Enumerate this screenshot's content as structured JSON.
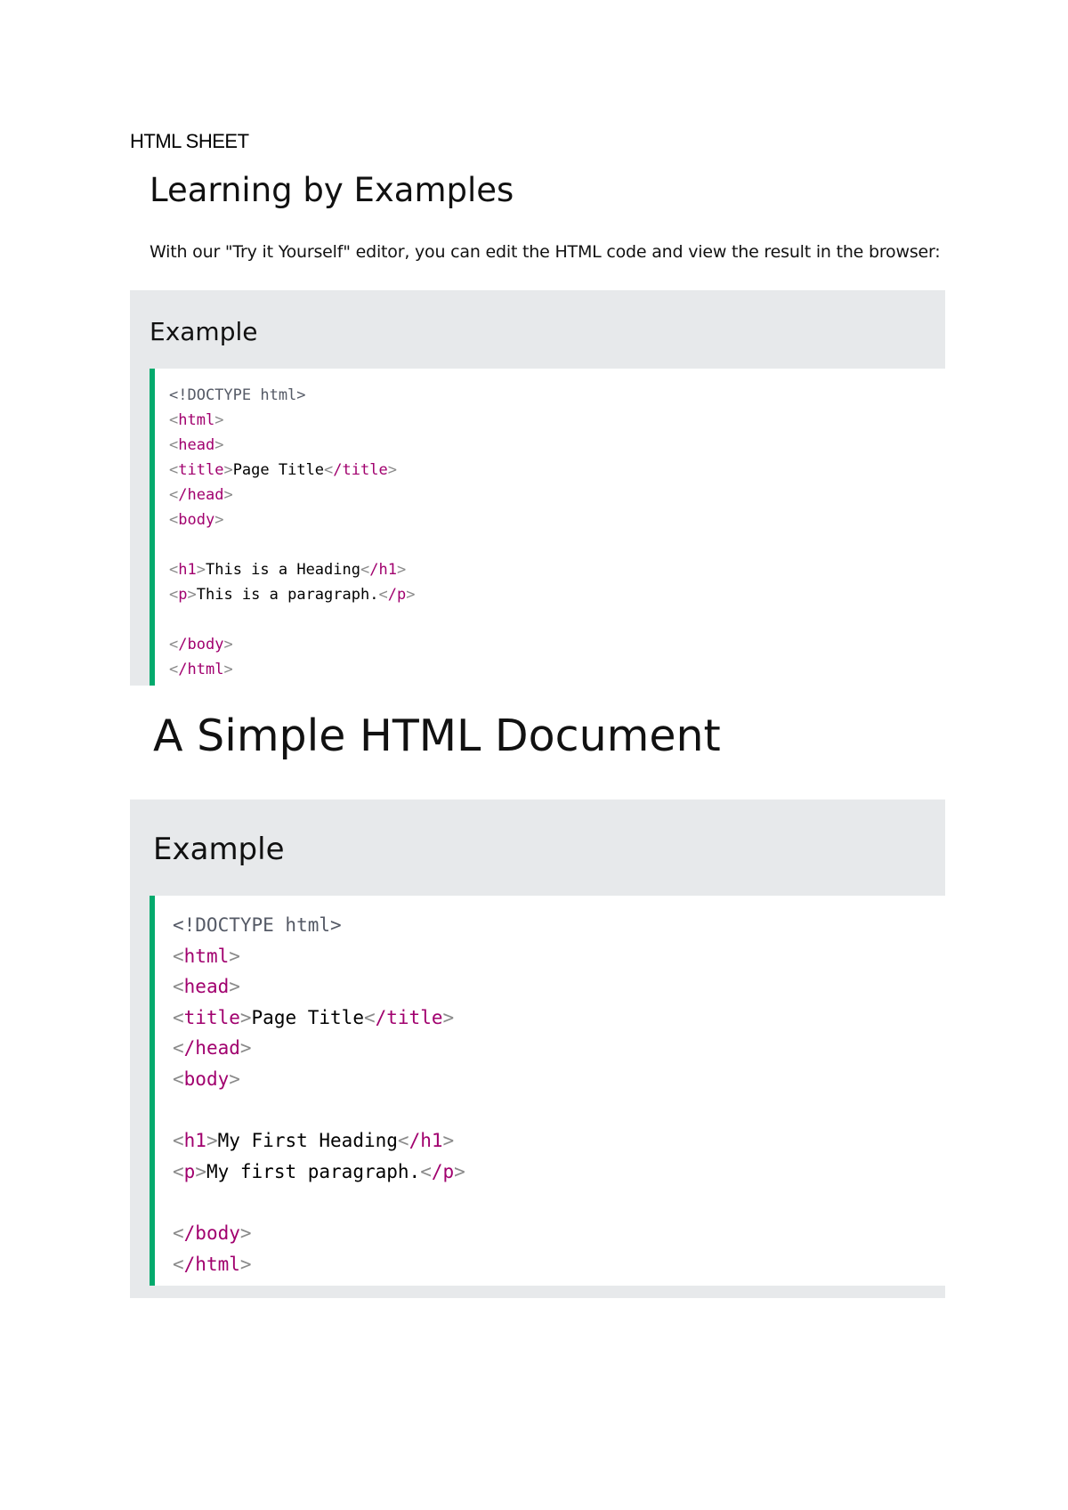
{
  "sheet_label": "HTML SHEET",
  "section1": {
    "heading": "Learning by Examples",
    "intro": "With our \"Try it Yourself\" editor, you can edit the HTML code and view the result in the browser:",
    "example_title": "Example",
    "code": {
      "doctype": "<!DOCTYPE html>",
      "title_text": "Page Title",
      "h1_text": "This is a Heading",
      "p_text": "This is a paragraph."
    }
  },
  "section2": {
    "heading": "A Simple HTML Document",
    "example_title": "Example",
    "code": {
      "doctype": "<!DOCTYPE html>",
      "title_text": "Page Title",
      "h1_text": "My First Heading",
      "p_text": "My first paragraph."
    }
  },
  "tags": {
    "open_br": "<",
    "close_br": ">",
    "html": "html",
    "head": "head",
    "title": "title",
    "body": "body",
    "h1": "h1",
    "p": "p",
    "end_html": "/html",
    "end_head": "/head",
    "end_title": "/title",
    "end_body": "/body",
    "end_h1": "/h1",
    "end_p": "/p"
  },
  "colors": {
    "box_background": "#e7e9eb",
    "accent_border": "#04aa6d",
    "tag_color": "#a1006e",
    "bracket_color": "#8a8a8a"
  }
}
